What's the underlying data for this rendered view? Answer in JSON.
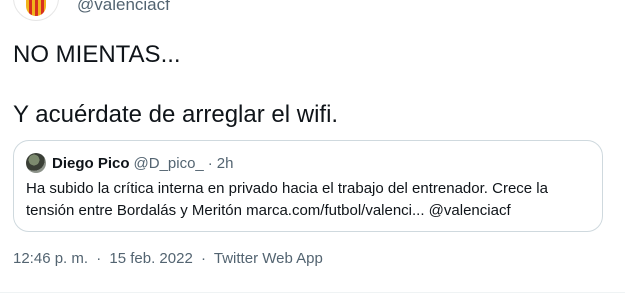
{
  "author": {
    "handle": "@valenciacf"
  },
  "tweet": {
    "lines": [
      "NO MIENTAS...",
      "Y acuérdate de arreglar el wifi."
    ]
  },
  "quoted_tweet": {
    "name": "Diego Pico",
    "handle": "@D_pico_",
    "separator": "·",
    "time": "2h",
    "text_lines": [
      "Ha subido la crítica interna en privado hacia el trabajo del entrenador. Crece la",
      "tensión entre Bordalás y Meritón marca.com/futbol/valenci... @valenciacf"
    ]
  },
  "meta": {
    "time": "12:46 p. m.",
    "separator": "·",
    "date": "15 feb. 2022",
    "source": "Twitter Web App"
  }
}
